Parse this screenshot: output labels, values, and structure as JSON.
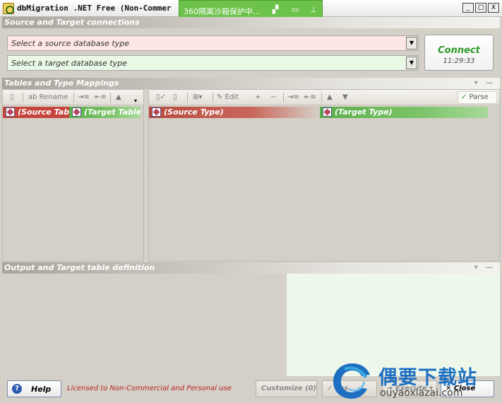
{
  "window": {
    "title": "dbMigration .NET Free (Non-Commer",
    "overlay_text": "360隔离沙箱保护中...",
    "buttons": [
      "_",
      "□",
      "X"
    ]
  },
  "sections": {
    "connections": "Source and Target connections",
    "mappings": "Tables and Type Mappings",
    "output": "Output and Target table definition"
  },
  "connection": {
    "source_placeholder": "Select a source database type",
    "target_placeholder": "Select a target database type",
    "connect_label": "Connect",
    "time": "11:29:33"
  },
  "tables_panel": {
    "toolbar": {
      "rename": "Rename"
    },
    "headers": {
      "source": "(Source Table",
      "target": "(Target Table)"
    }
  },
  "types_panel": {
    "toolbar": {
      "edit": "Edit",
      "parse": "Parse"
    },
    "headers": {
      "source": "(Source Type)",
      "target": "(Target Type)"
    }
  },
  "footer": {
    "help": "Help",
    "license": "Licensed to Non-Commercial and Personal use",
    "customize": "Customize (0)",
    "test": "Tes",
    "execute": "Execute",
    "close": "Close"
  },
  "watermark": {
    "title": "偶要下载站",
    "url": "ouyaoxiazai.com"
  },
  "colors": {
    "source_red": "#c6463e",
    "target_green": "#6cbf58",
    "connect_green": "#2d9a25",
    "license_red": "#b82424"
  }
}
